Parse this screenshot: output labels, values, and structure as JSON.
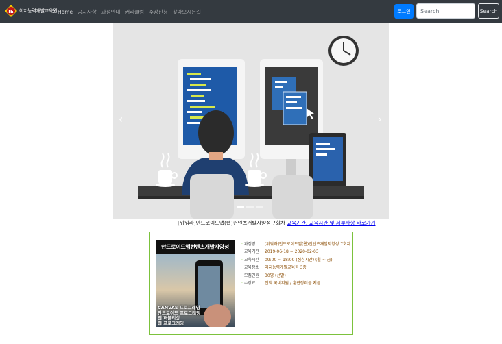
{
  "navbar": {
    "brand_text": "이지능력개발교육원",
    "links": [
      "Home",
      "공지사항",
      "과정안내",
      "커리큘럼",
      "수강신청",
      "찾아오시는길"
    ],
    "login_label": "로그인",
    "search_placeholder": "Search",
    "search_button": "Search"
  },
  "carousel": {
    "prev_glyph": "‹",
    "next_glyph": "›",
    "slide_count": 3,
    "active_index": 0
  },
  "caption": {
    "text": "[위워라]안드로이드앱(웹)컨텐츠개발자양성 7회차",
    "link_text": "교육기간, 교육시간 및 세부사항 바로가기"
  },
  "course": {
    "poster_title": "안드로이드앱컨텐츠개발자양성",
    "poster_lines": [
      "CANVAS 프로그래밍",
      "안드로이드 프로그래밍",
      "웹 퍼블리싱",
      "웹 프로그래밍"
    ],
    "rows": [
      {
        "key": "과정명",
        "value": "[위워라]안드로이드앱(웹)컨텐츠개발자양성 7회차"
      },
      {
        "key": "교육기간",
        "value": "2019-06-18 ~ 2020-02-03"
      },
      {
        "key": "교육시간",
        "value": "09:00 ~ 18:00 (점심시간) (월 ~ 금)"
      },
      {
        "key": "교육장소",
        "value": "이지능력개발교육원 3층"
      },
      {
        "key": "모집인원",
        "value": "30명 (선발)"
      },
      {
        "key": "수강료",
        "value": "전액 국비지원 / 훈련장려금 지급"
      }
    ]
  },
  "colors": {
    "navbar_bg": "#343a40",
    "primary": "#007bff",
    "card_border": "#7cc23d"
  }
}
